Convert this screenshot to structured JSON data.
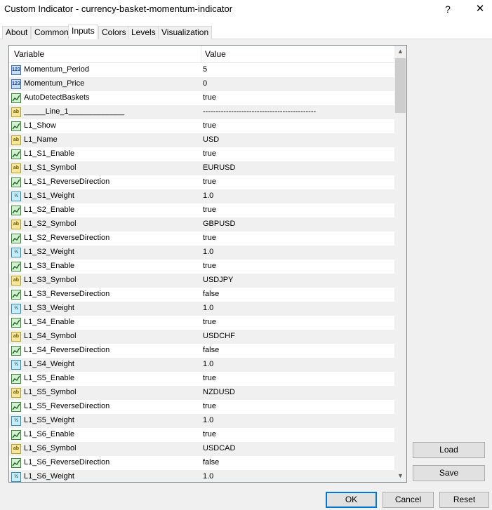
{
  "window": {
    "title": "Custom Indicator - currency-basket-momentum-indicator",
    "help_label": "?",
    "close_label": "✕"
  },
  "tabs": [
    {
      "label": "About"
    },
    {
      "label": "Common"
    },
    {
      "label": "Inputs",
      "active": true
    },
    {
      "label": "Colors"
    },
    {
      "label": "Levels"
    },
    {
      "label": "Visualization"
    }
  ],
  "grid": {
    "col_variable": "Variable",
    "col_value": "Value",
    "rows": [
      {
        "type": "int",
        "icon": "integer-icon",
        "badge": "123",
        "name": "Momentum_Period",
        "value": "5"
      },
      {
        "type": "int",
        "icon": "integer-icon",
        "badge": "123",
        "name": "Momentum_Price",
        "value": "0"
      },
      {
        "type": "bool",
        "icon": "boolean-icon",
        "badge": "",
        "name": "AutoDetectBaskets",
        "value": "true"
      },
      {
        "type": "str",
        "icon": "string-icon",
        "badge": "ab",
        "name": "_____Line_1_____________",
        "value": "--------------------------------------------"
      },
      {
        "type": "bool",
        "icon": "boolean-icon",
        "badge": "",
        "name": "L1_Show",
        "value": "true"
      },
      {
        "type": "str",
        "icon": "string-icon",
        "badge": "ab",
        "name": "L1_Name",
        "value": "USD"
      },
      {
        "type": "bool",
        "icon": "boolean-icon",
        "badge": "",
        "name": "L1_S1_Enable",
        "value": "true"
      },
      {
        "type": "str",
        "icon": "string-icon",
        "badge": "ab",
        "name": "L1_S1_Symbol",
        "value": "EURUSD"
      },
      {
        "type": "bool",
        "icon": "boolean-icon",
        "badge": "",
        "name": "L1_S1_ReverseDirection",
        "value": "true"
      },
      {
        "type": "dbl",
        "icon": "double-icon",
        "badge": "½",
        "name": "L1_S1_Weight",
        "value": "1.0"
      },
      {
        "type": "bool",
        "icon": "boolean-icon",
        "badge": "",
        "name": "L1_S2_Enable",
        "value": "true"
      },
      {
        "type": "str",
        "icon": "string-icon",
        "badge": "ab",
        "name": "L1_S2_Symbol",
        "value": "GBPUSD"
      },
      {
        "type": "bool",
        "icon": "boolean-icon",
        "badge": "",
        "name": "L1_S2_ReverseDirection",
        "value": "true"
      },
      {
        "type": "dbl",
        "icon": "double-icon",
        "badge": "½",
        "name": "L1_S2_Weight",
        "value": "1.0"
      },
      {
        "type": "bool",
        "icon": "boolean-icon",
        "badge": "",
        "name": "L1_S3_Enable",
        "value": "true"
      },
      {
        "type": "str",
        "icon": "string-icon",
        "badge": "ab",
        "name": "L1_S3_Symbol",
        "value": "USDJPY"
      },
      {
        "type": "bool",
        "icon": "boolean-icon",
        "badge": "",
        "name": "L1_S3_ReverseDirection",
        "value": "false"
      },
      {
        "type": "dbl",
        "icon": "double-icon",
        "badge": "½",
        "name": "L1_S3_Weight",
        "value": "1.0"
      },
      {
        "type": "bool",
        "icon": "boolean-icon",
        "badge": "",
        "name": "L1_S4_Enable",
        "value": "true"
      },
      {
        "type": "str",
        "icon": "string-icon",
        "badge": "ab",
        "name": "L1_S4_Symbol",
        "value": "USDCHF"
      },
      {
        "type": "bool",
        "icon": "boolean-icon",
        "badge": "",
        "name": "L1_S4_ReverseDirection",
        "value": "false"
      },
      {
        "type": "dbl",
        "icon": "double-icon",
        "badge": "½",
        "name": "L1_S4_Weight",
        "value": "1.0"
      },
      {
        "type": "bool",
        "icon": "boolean-icon",
        "badge": "",
        "name": "L1_S5_Enable",
        "value": "true"
      },
      {
        "type": "str",
        "icon": "string-icon",
        "badge": "ab",
        "name": "L1_S5_Symbol",
        "value": "NZDUSD"
      },
      {
        "type": "bool",
        "icon": "boolean-icon",
        "badge": "",
        "name": "L1_S5_ReverseDirection",
        "value": "true"
      },
      {
        "type": "dbl",
        "icon": "double-icon",
        "badge": "½",
        "name": "L1_S5_Weight",
        "value": "1.0"
      },
      {
        "type": "bool",
        "icon": "boolean-icon",
        "badge": "",
        "name": "L1_S6_Enable",
        "value": "true"
      },
      {
        "type": "str",
        "icon": "string-icon",
        "badge": "ab",
        "name": "L1_S6_Symbol",
        "value": "USDCAD"
      },
      {
        "type": "bool",
        "icon": "boolean-icon",
        "badge": "",
        "name": "L1_S6_ReverseDirection",
        "value": "false"
      },
      {
        "type": "dbl",
        "icon": "double-icon",
        "badge": "½",
        "name": "L1_S6_Weight",
        "value": "1.0"
      }
    ]
  },
  "side_buttons": {
    "load_label": "Load",
    "save_label": "Save"
  },
  "footer": {
    "ok_label": "OK",
    "cancel_label": "Cancel",
    "reset_label": "Reset"
  },
  "colors": {
    "accent": "#0078d7",
    "row_alt": "#f0f0f0"
  }
}
